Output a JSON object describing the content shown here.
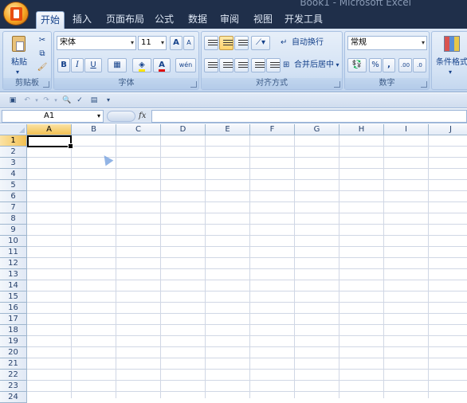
{
  "window": {
    "title": "Book1 - Microsoft Excel"
  },
  "tabs": [
    {
      "label": "开始",
      "active": true
    },
    {
      "label": "插入"
    },
    {
      "label": "页面布局"
    },
    {
      "label": "公式"
    },
    {
      "label": "数据"
    },
    {
      "label": "审阅"
    },
    {
      "label": "视图"
    },
    {
      "label": "开发工具"
    }
  ],
  "ribbon": {
    "clipboard": {
      "label": "剪贴板",
      "paste_label": "粘贴"
    },
    "font": {
      "label": "字体",
      "font_name": "宋体",
      "font_size": "11",
      "bold": "B",
      "italic": "I",
      "underline": "U",
      "grow": "A",
      "shrink": "A",
      "font_color": "A",
      "phonetic": "wén"
    },
    "alignment": {
      "label": "对齐方式",
      "wrap_text": "自动换行",
      "merge_center": "合并后居中"
    },
    "number": {
      "label": "数字",
      "format": "常规",
      "percent": "%",
      "comma": ",",
      "inc_decimal": ".00",
      "dec_decimal": ".0"
    },
    "styles": {
      "conditional_format": "条件格式"
    }
  },
  "formula_bar": {
    "name_box": "A1",
    "fx": "fx",
    "formula": ""
  },
  "grid": {
    "columns": [
      "A",
      "B",
      "C",
      "D",
      "E",
      "F",
      "G",
      "H",
      "I",
      "J"
    ],
    "rows": [
      "1",
      "2",
      "3",
      "4",
      "5",
      "6",
      "7",
      "8",
      "9",
      "10",
      "11",
      "12",
      "13",
      "14",
      "15",
      "16",
      "17",
      "18",
      "19",
      "20",
      "21",
      "22",
      "23",
      "24"
    ],
    "selected_cell": "A1"
  },
  "colors": {
    "ribbon": "#c9dbf1",
    "header_selected": "#f2c052",
    "titlebar": "#1f2f4a"
  }
}
